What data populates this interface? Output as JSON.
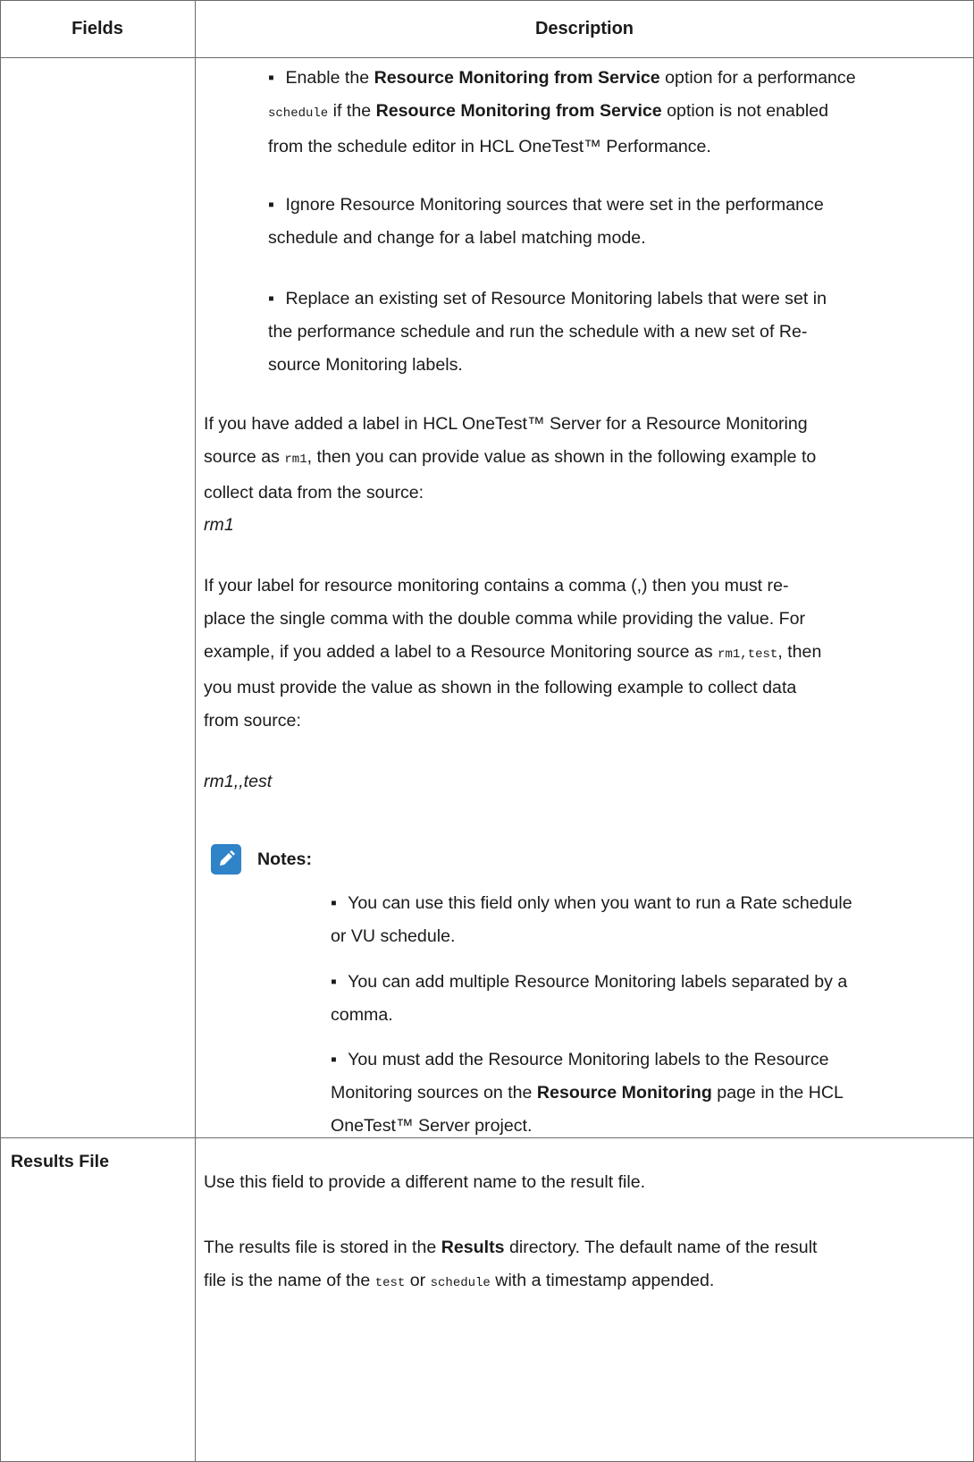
{
  "table": {
    "headers": {
      "fields": "Fields",
      "description": "Description"
    },
    "row1": {
      "bullets": [
        {
          "pre": "Enable the ",
          "b1": "Resource Monitoring from Service",
          "mid": " option for a performance",
          "code": "schedule",
          "mid2": " if the ",
          "b2": "Resource Monitoring from Service",
          "post": " option is not enabled",
          "line3": "from the schedule editor in HCL OneTest™ Performance."
        },
        {
          "line1": "Ignore Resource Monitoring sources that were set in the performance",
          "line2": "schedule and change for a label matching mode."
        },
        {
          "line1": "Replace an existing set of Resource Monitoring labels that were set in",
          "line2": "the performance schedule and run the schedule with a new set of Re-",
          "line3": "source Monitoring labels."
        }
      ],
      "para1": {
        "line1": "If you have added a label in HCL OneTest™ Server for a Resource Monitoring",
        "pre2": "source as ",
        "code": "rm1",
        "post2": ", then you can provide value as shown in the following example to",
        "line3": "collect data from the source:"
      },
      "example1": "rm1",
      "para2": {
        "line1": "If your label for resource monitoring contains a comma (,) then you must re-",
        "line2": "place the single comma with the double comma while providing the value. For",
        "pre3": "example, if you added a label to a Resource Monitoring source as ",
        "code": "rm1,test",
        "post3": ", then",
        "line4": "you must provide the value as shown in the following example to collect data",
        "line5": "from source:"
      },
      "example2": "rm1,,test",
      "notes": {
        "title": "Notes:",
        "icon": "pencil-icon",
        "items": [
          {
            "line1": "You can use this field only when you want to run a Rate schedule",
            "line2": "or VU schedule."
          },
          {
            "line1": "You can add multiple Resource Monitoring labels separated by a",
            "line2": "comma."
          },
          {
            "line1": "You must add the Resource Monitoring labels to the Resource",
            "pre2": "Monitoring sources on the ",
            "b2": "Resource Monitoring",
            "post2": " page in the HCL",
            "line3": "OneTest™ Server project."
          }
        ]
      }
    },
    "row2": {
      "field": "Results File",
      "para1": "Use this field to provide a different name to the result file.",
      "para2": {
        "pre1": "The results file is stored in the ",
        "b1": "Results",
        "post1": " directory. The default name of the result",
        "pre2": "file is the name of the ",
        "code1": "test",
        "mid2": " or ",
        "code2": "schedule",
        "post2": " with a timestamp appended."
      }
    }
  },
  "colors": {
    "border": "#6b6b6b",
    "note_icon": "#2f83c8",
    "text": "#1a1a1a"
  }
}
